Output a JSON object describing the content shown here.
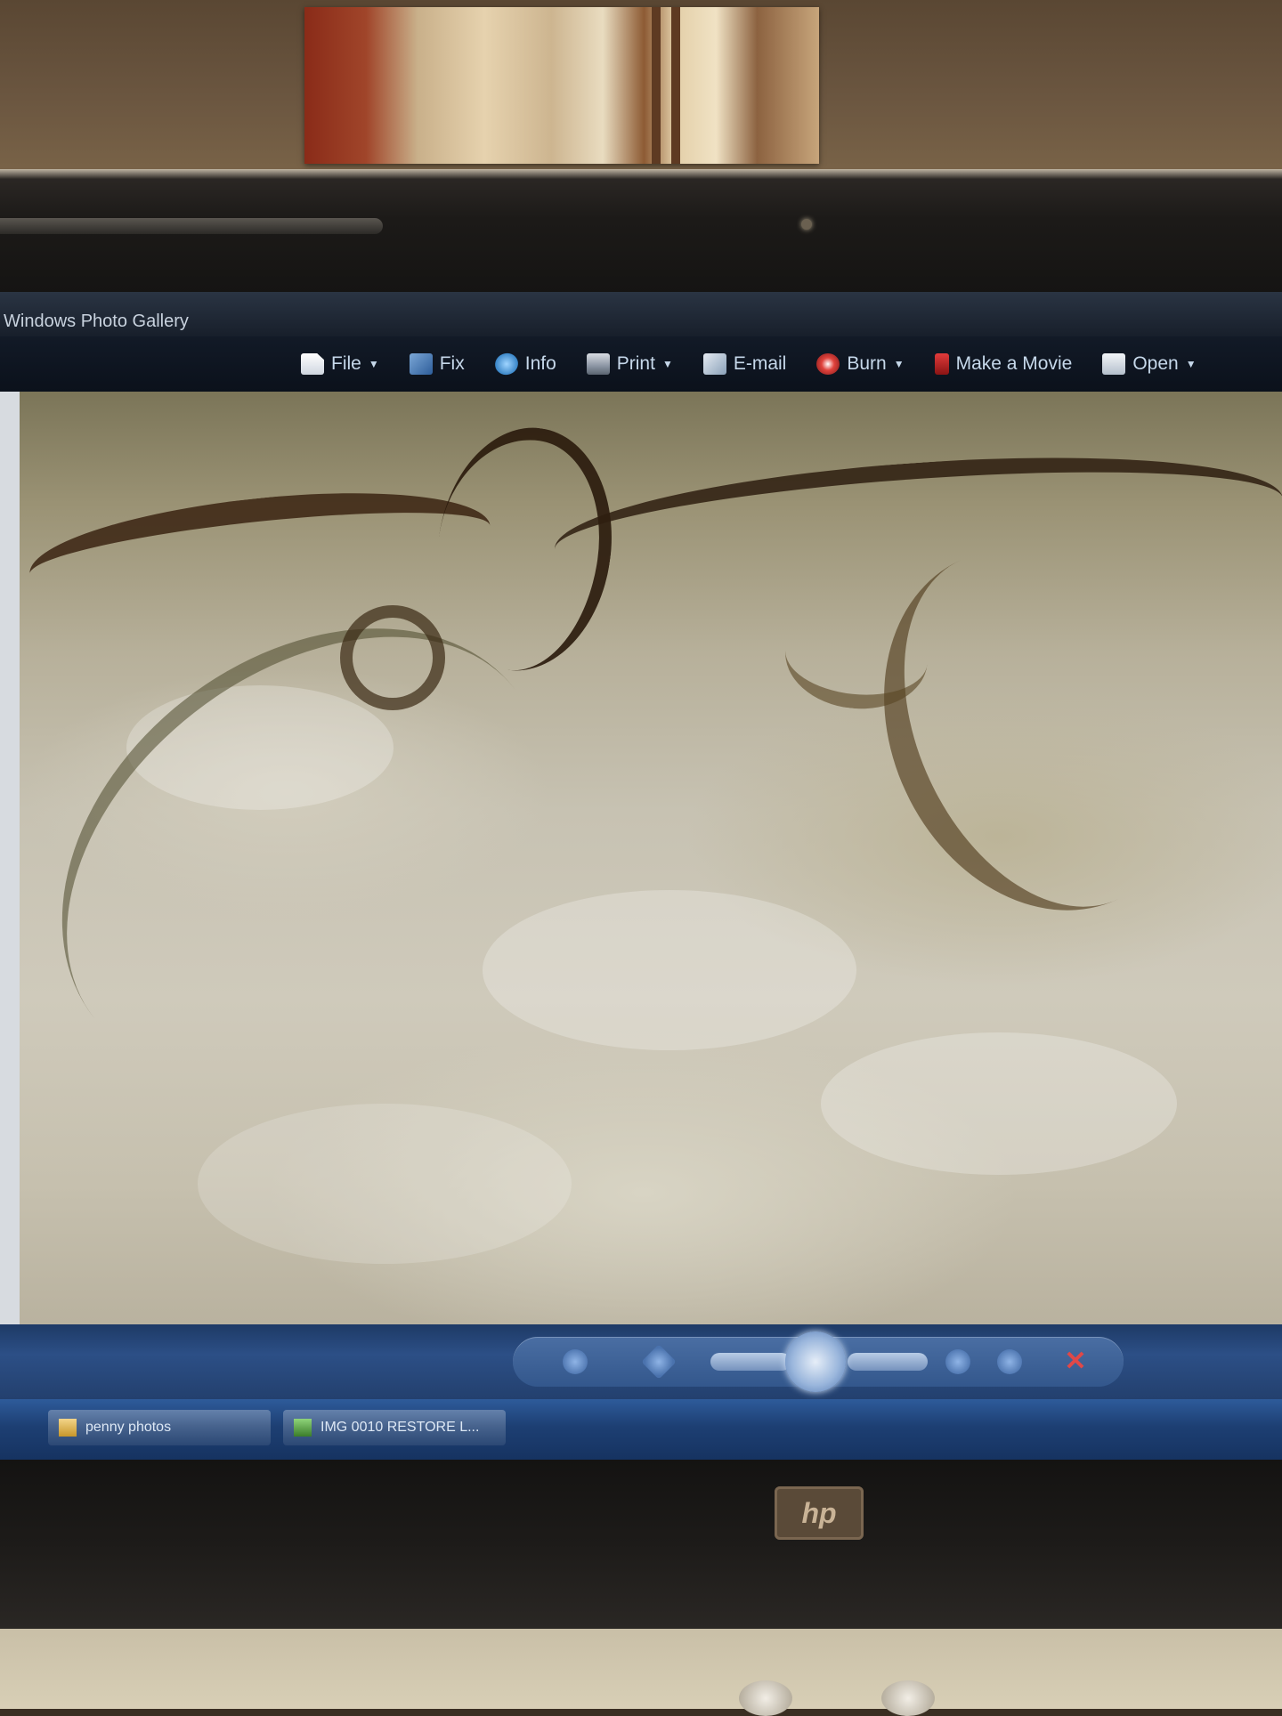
{
  "window": {
    "title": "Windows Photo Gallery"
  },
  "toolbar": {
    "items": [
      {
        "label": "File",
        "icon": "file-icon",
        "dropdown": true
      },
      {
        "label": "Fix",
        "icon": "fix-icon",
        "dropdown": false
      },
      {
        "label": "Info",
        "icon": "info-icon",
        "dropdown": false
      },
      {
        "label": "Print",
        "icon": "printer-icon",
        "dropdown": true
      },
      {
        "label": "E-mail",
        "icon": "email-icon",
        "dropdown": false
      },
      {
        "label": "Burn",
        "icon": "burn-disc-icon",
        "dropdown": true
      },
      {
        "label": "Make a Movie",
        "icon": "movie-icon",
        "dropdown": false
      },
      {
        "label": "Open",
        "icon": "open-icon",
        "dropdown": true
      }
    ]
  },
  "controls": {
    "delete_glyph": "✕"
  },
  "taskbar": {
    "items": [
      {
        "label": "penny photos",
        "icon": "folder-icon"
      },
      {
        "label": "IMG 0010 RESTORE L...",
        "icon": "photo-gallery-icon"
      }
    ]
  },
  "laptop": {
    "logo_text": "hp"
  },
  "colors": {
    "toolbar_bg": "#0b111b",
    "toolbar_text": "#c6d8ea",
    "taskbar_bg": "#1d3f73",
    "control_bar_bg": "#2c4f86"
  }
}
